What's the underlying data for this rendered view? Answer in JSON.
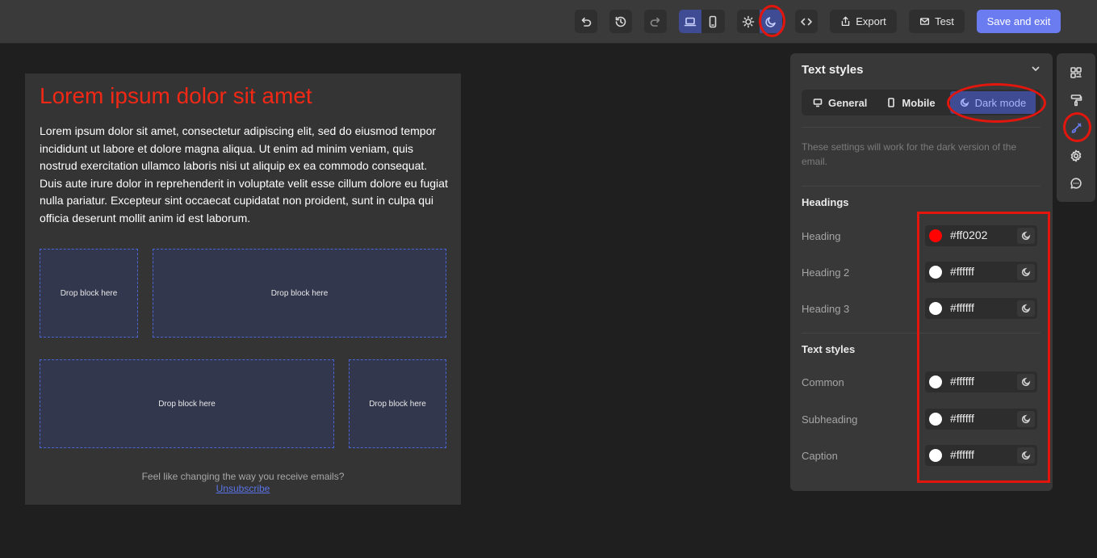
{
  "toolbar": {
    "export_label": "Export",
    "test_label": "Test",
    "save_label": "Save and exit",
    "icons": [
      "undo-icon",
      "history-icon",
      "redo-icon",
      "desktop-icon",
      "mobile-icon",
      "sun-icon",
      "moon-icon",
      "code-icon",
      "export-icon",
      "mail-icon"
    ]
  },
  "email": {
    "heading": "Lorem ipsum dolor sit amet",
    "paragraph": "Lorem ipsum dolor sit amet, consectetur adipiscing elit, sed do eiusmod tempor incididunt ut labore et dolore magna aliqua. Ut enim ad minim veniam, quis nostrud exercitation ullamco laboris nisi ut aliquip ex ea commodo consequat. Duis aute irure dolor in reprehenderit in voluptate velit esse cillum dolore eu fugiat nulla pariatur. Excepteur sint occaecat cupidatat non proident, sunt in culpa qui officia deserunt mollit anim id est laborum.",
    "drop_label": "Drop block here",
    "footer_note": "Feel like changing the way you receive emails?",
    "unsubscribe": "Unsubscribe"
  },
  "panel": {
    "title": "Text styles",
    "tabs": {
      "general": "General",
      "mobile": "Mobile",
      "dark": "Dark mode"
    },
    "hint": "These settings will work for the dark version of the email.",
    "headings_section": "Headings",
    "text_section": "Text styles",
    "headings": [
      {
        "label": "Heading",
        "hex": "#ff0202",
        "color": "#ff0202"
      },
      {
        "label": "Heading 2",
        "hex": "#ffffff",
        "color": "#ffffff"
      },
      {
        "label": "Heading 3",
        "hex": "#ffffff",
        "color": "#ffffff"
      }
    ],
    "texts": [
      {
        "label": "Common",
        "hex": "#ffffff",
        "color": "#ffffff"
      },
      {
        "label": "Subheading",
        "hex": "#ffffff",
        "color": "#ffffff"
      },
      {
        "label": "Caption",
        "hex": "#ffffff",
        "color": "#ffffff"
      }
    ]
  },
  "rail": {
    "icons": [
      "blocks-icon",
      "paint-roller-icon",
      "brush-icon",
      "gear-icon",
      "chat-icon"
    ]
  },
  "colors": {
    "accent": "#6b7cf0",
    "annotation": "#e3160e",
    "heading_red": "#f12815"
  }
}
